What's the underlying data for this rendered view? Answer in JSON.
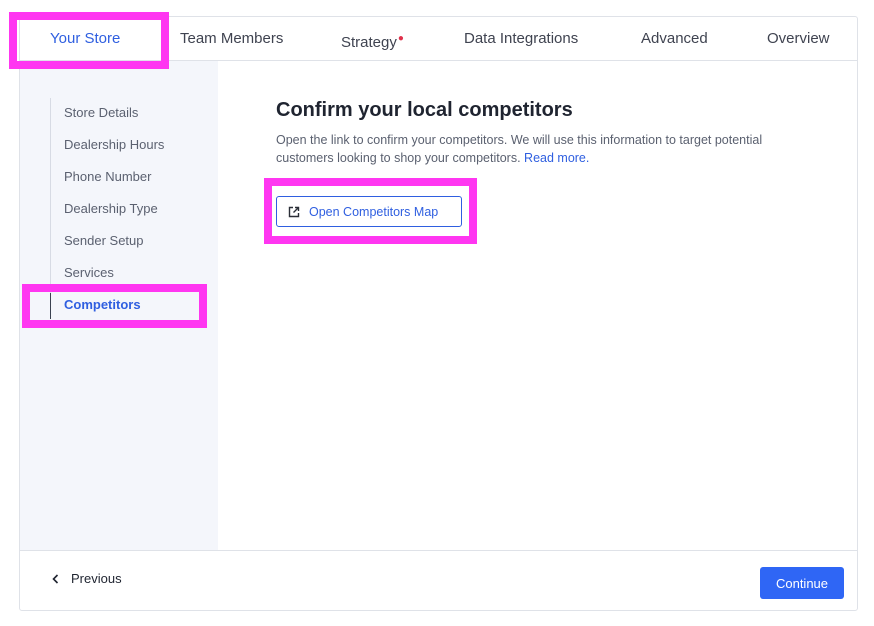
{
  "tabs": [
    {
      "label": "Your Store",
      "active": true
    },
    {
      "label": "Team Members",
      "active": false
    },
    {
      "label": "Strategy",
      "active": false,
      "required": true
    },
    {
      "label": "Data Integrations",
      "active": false
    },
    {
      "label": "Advanced",
      "active": false
    },
    {
      "label": "Overview",
      "active": false
    }
  ],
  "sidebar": {
    "items": [
      {
        "label": "Store Details"
      },
      {
        "label": "Dealership Hours"
      },
      {
        "label": "Phone Number"
      },
      {
        "label": "Dealership Type"
      },
      {
        "label": "Sender Setup"
      },
      {
        "label": "Services"
      },
      {
        "label": "Competitors",
        "active": true
      }
    ]
  },
  "main": {
    "heading": "Confirm your local competitors",
    "description": "Open the link to confirm your competitors. We will use this information to target potential customers looking to shop your competitors.",
    "read_more": "Read more.",
    "open_map_button": "Open Competitors Map"
  },
  "footer": {
    "previous_label": "Previous",
    "continue_label": "Continue"
  },
  "colors": {
    "accent": "#2f5fe0",
    "primary_button": "#2f66f5",
    "highlight": "#ff36f1",
    "required_dot": "#e0314b",
    "sidebar_bg": "#f4f6fb"
  },
  "icons": {
    "open_map": "external-link-icon",
    "previous": "chevron-left-icon"
  }
}
